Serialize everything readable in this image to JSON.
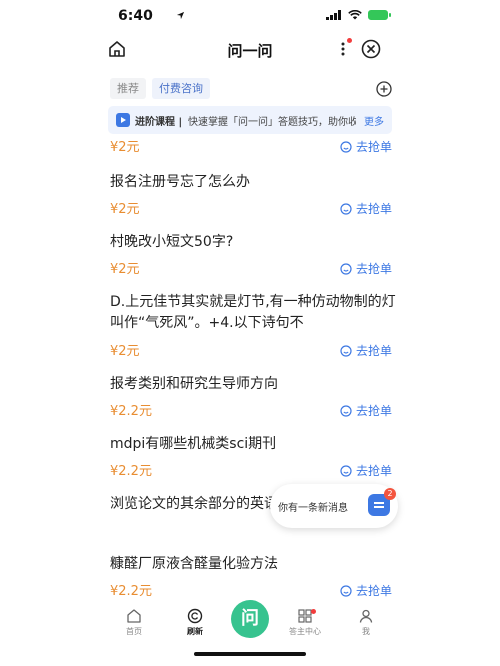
{
  "status": {
    "time": "6:40"
  },
  "nav": {
    "title": "问一问"
  },
  "filters": {
    "recommend": "推荐",
    "paid": "付费咨询"
  },
  "banner": {
    "title": "进阶课程 |",
    "text": "快速掌握「问一问」答题技巧，助你收益翻...",
    "more": "更多"
  },
  "items": [
    {
      "title": "",
      "price": "¥2元",
      "action": "去抢单"
    },
    {
      "title": "报名注册号忘了怎么办",
      "price": "¥2元",
      "action": "去抢单"
    },
    {
      "title": "村晚改小短文50字?",
      "price": "¥2元",
      "action": "去抢单"
    },
    {
      "title": "D.上元佳节其实就是灯节,有一种仿动物制的灯叫作“气死风”。+4.以下诗句不",
      "price": "¥2元",
      "action": "去抢单"
    },
    {
      "title": "报考类别和研究生导师方向",
      "price": "¥2.2元",
      "action": "去抢单"
    },
    {
      "title": "mdpi有哪些机械类sci期刊",
      "price": "¥2.2元",
      "action": "去抢单"
    },
    {
      "title": "浏览论文的其余部分的英语",
      "price": "",
      "action": ""
    },
    {
      "title": "糠醛厂原液含醛量化验方法",
      "price": "¥2.2元",
      "action": "去抢单"
    }
  ],
  "toast": {
    "text": "你有一条新消息",
    "badge": "2"
  },
  "tabs": [
    {
      "label": "首页",
      "icon": "home-icon"
    },
    {
      "label": "刷新",
      "icon": "refresh-icon"
    },
    {
      "label": "问",
      "icon": "ask-icon"
    },
    {
      "label": "答主中心",
      "icon": "grid-icon"
    },
    {
      "label": "我",
      "icon": "user-icon"
    }
  ],
  "colors": {
    "accent": "#3d78e3",
    "price": "#e88d32",
    "center": "#37c38f"
  }
}
